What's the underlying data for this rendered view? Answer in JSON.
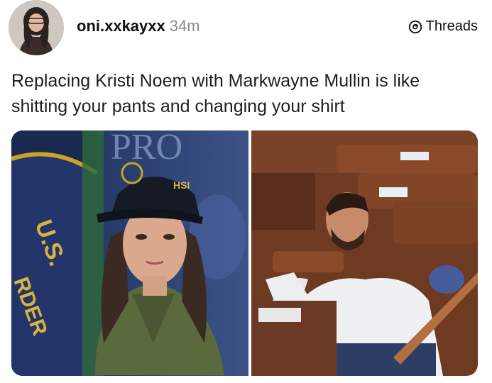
{
  "post": {
    "username": "oni.xxkayxx",
    "time": "34m",
    "platform": "Threads",
    "text": "Replacing Kristi Noem with Markwayne Mullin is like shitting your pants and changing your shirt"
  },
  "images": {
    "left": {
      "sign_text": "PRO",
      "seal_text": "U.S.",
      "seal_text2": "RDER",
      "cap_text": "HSI"
    }
  },
  "icons": {
    "threads": "threads-logo-icon"
  }
}
